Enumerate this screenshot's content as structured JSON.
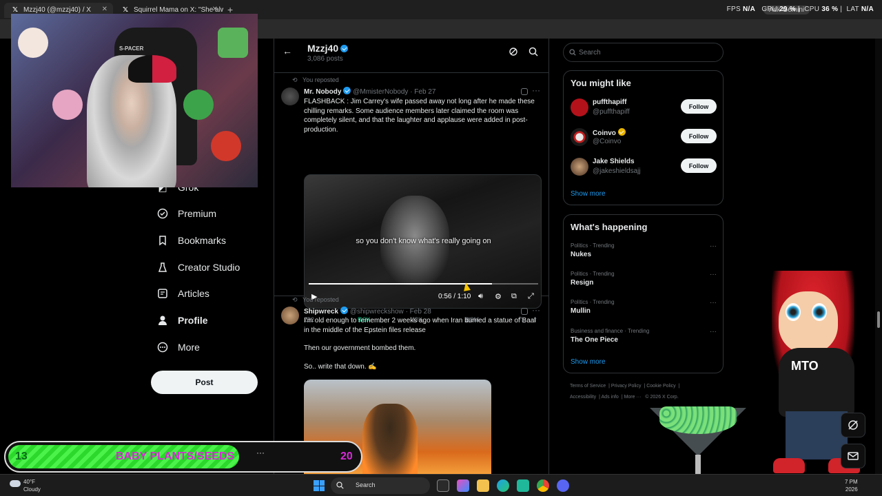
{
  "browser": {
    "tabs": [
      {
        "title": "Mzzj40 (@mzzj40) / X",
        "active": true
      },
      {
        "title": "Squirrel Mama on X: \"She alw",
        "active": false
      }
    ],
    "perf": {
      "fps_label": "FPS",
      "fps": "N/A",
      "gpu_label": "GPU",
      "gpu": "29 %",
      "cpu_label": "CPU",
      "cpu": "36 %",
      "lat_label": "LAT",
      "lat": "N/A"
    },
    "ask_gemini": "Ask Gemini"
  },
  "sidebar": {
    "items": [
      {
        "label": "Grok",
        "icon": "grok-icon"
      },
      {
        "label": "Premium",
        "icon": "premium-icon"
      },
      {
        "label": "Bookmarks",
        "icon": "bookmark-icon"
      },
      {
        "label": "Creator Studio",
        "icon": "creator-studio-icon"
      },
      {
        "label": "Articles",
        "icon": "articles-icon"
      },
      {
        "label": "Profile",
        "icon": "profile-icon",
        "active": true
      },
      {
        "label": "More",
        "icon": "more-icon"
      }
    ],
    "post_button": "Post"
  },
  "profile_header": {
    "name": "Mzzj40",
    "posts": "3,086 posts"
  },
  "posts": [
    {
      "reposted": "You reposted",
      "display_name": "Mr. Nobody",
      "handle": "@MmisterNobody",
      "date": "· Feb 27",
      "text": "FLASHBACK : Jim Carrey's wife passed away not long after he made these chilling remarks. Some audience members later claimed the room was completely silent, and that the laughter and applause were added in post-production.",
      "video": {
        "caption": "so you don't know what's really going on",
        "time": "0:56 / 1:10",
        "progress": 0.8
      },
      "stats": {
        "replies": "232",
        "reposts": "5.3K",
        "likes": "43K",
        "views": "2.8M"
      }
    },
    {
      "reposted": "You reposted",
      "display_name": "Shipwreck",
      "handle": "@shipwreckshow",
      "date": "· Feb 28",
      "text_lines": [
        "I'm old enough to remember 2 weeks ago when Iran burned a statue of Baal in the middle of the Epstein files release",
        "Then our government bombed them.",
        "So.. write that down. ✍️"
      ]
    }
  ],
  "right": {
    "search_placeholder": "Search",
    "you_might_like": {
      "title": "You might like",
      "accounts": [
        {
          "name": "puffthapiff",
          "handle": "@puffthapiff",
          "follow": "Follow",
          "avatar_color": "#b3121b"
        },
        {
          "name": "Coinvo",
          "handle": "@Coinvo",
          "follow": "Follow",
          "avatar_color": "#d9d9d9",
          "verified": "gold"
        },
        {
          "name": "Jake Shields",
          "handle": "@jakeshieldsajj",
          "follow": "Follow",
          "avatar_color": "#7a6050"
        }
      ],
      "show_more": "Show more"
    },
    "whats_happening": {
      "title": "What's happening",
      "trends": [
        {
          "category": "Politics · Trending",
          "topic": "Nukes"
        },
        {
          "category": "Politics · Trending",
          "topic": "Resign"
        },
        {
          "category": "Politics · Trending",
          "topic": "Mullin"
        },
        {
          "category": "Business and finance · Trending",
          "topic": "The One Piece"
        }
      ],
      "show_more": "Show more"
    },
    "footer": [
      "Terms of Service",
      "Privacy Policy",
      "Cookie Policy",
      "Accessibility",
      "Ads info",
      "More ···",
      "© 2026 X Corp."
    ]
  },
  "overlay": {
    "webcam_banner": "S-PACER",
    "goal": {
      "current": "13",
      "label": "BABY PLANTS/SEEDS",
      "max": "20",
      "fill_fraction": 0.65,
      "dots": "···"
    },
    "mascot_text": "MTO"
  },
  "taskbar": {
    "weather_temp": "40°F",
    "weather_cond": "Cloudy",
    "search": "Search",
    "time": "7 PM",
    "date": "2026"
  },
  "colors": {
    "accent": "#1d9bf0",
    "retweet": "#00ba7c",
    "goal_green": "#2bd82b",
    "goal_text": "#d62bd6"
  }
}
